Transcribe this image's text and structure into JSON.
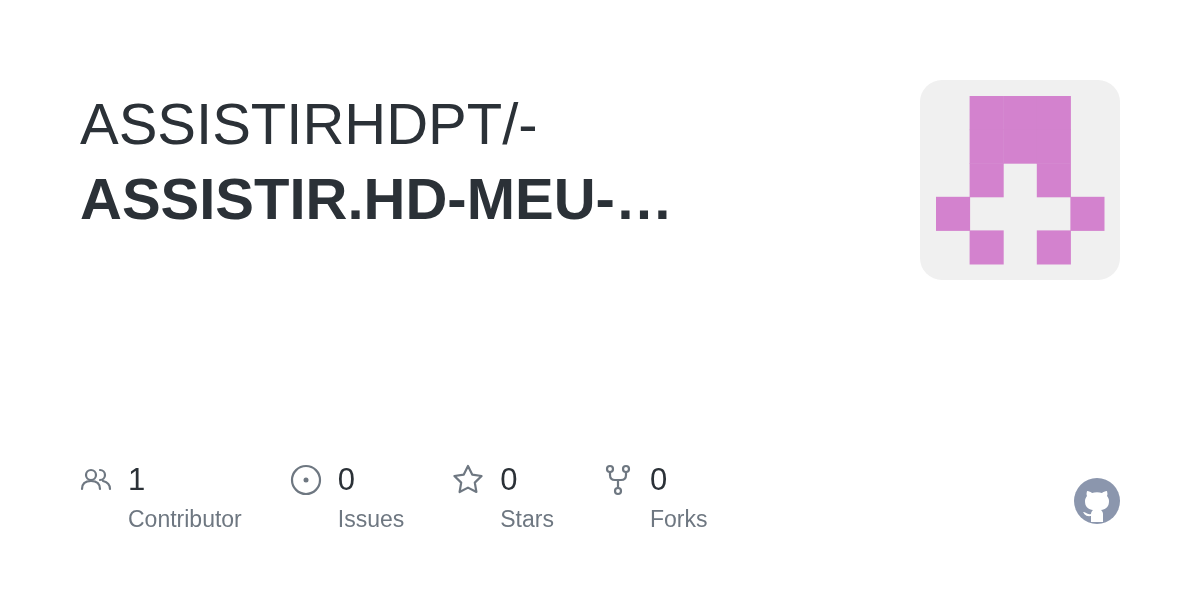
{
  "title": {
    "owner": "ASSISTIRHDPT/-",
    "repo": "ASSISTIR.HD-MEU-…"
  },
  "stats": [
    {
      "kind": "contributors",
      "value": "1",
      "label": "Contributor"
    },
    {
      "kind": "issues",
      "value": "0",
      "label": "Issues"
    },
    {
      "kind": "stars",
      "value": "0",
      "label": "Stars"
    },
    {
      "kind": "forks",
      "value": "0",
      "label": "Forks"
    }
  ]
}
